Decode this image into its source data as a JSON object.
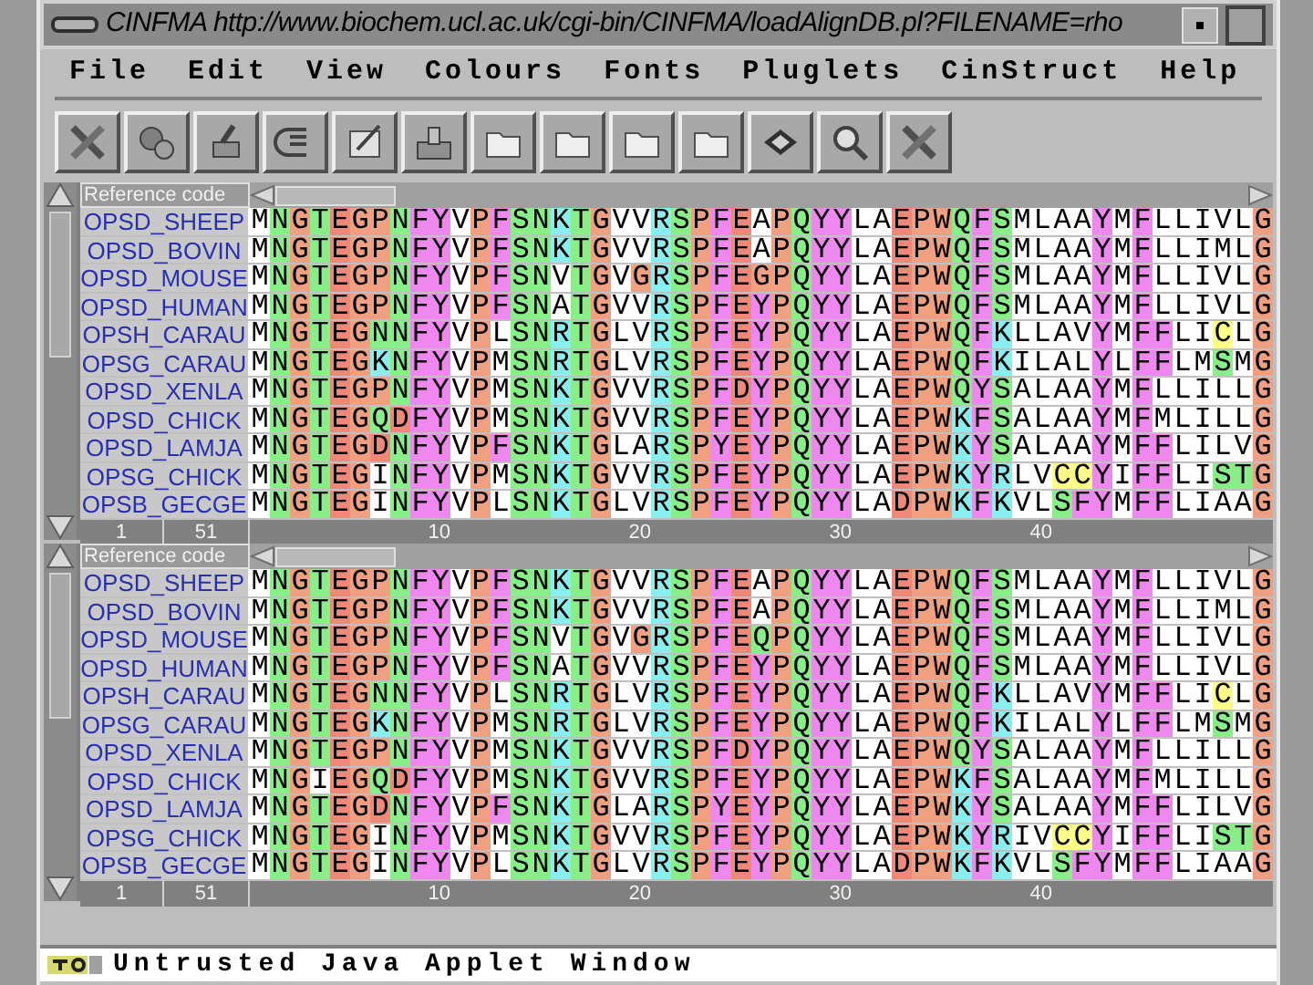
{
  "window": {
    "title": "CINFMA http://www.biochem.ucl.ac.uk/cgi-bin/CINFMA/loadAlignDB.pl?FILENAME=rho"
  },
  "menu": [
    "File",
    "Edit",
    "View",
    "Colours",
    "Fonts",
    "Pluglets",
    "CinStruct",
    "Help"
  ],
  "panels": [
    {
      "header": "Reference code",
      "start": "1",
      "end": "51",
      "ruler": [
        "10",
        "20",
        "30",
        "40"
      ],
      "rows": [
        {
          "name": "OPSD_SHEEP",
          "sequence": "MNGTEGPNFYVPFSNKTGVVRSPFEAPQYYLAEPWQFSMLAAYMFLLIVLG"
        },
        {
          "name": "OPSD_BOVIN",
          "sequence": "MNGTEGPNFYVPFSNKTGVVRSPFEAPQYYLAEPWQFSMLAAYMFLLIMLG"
        },
        {
          "name": "OPSD_MOUSE",
          "sequence": "MNGTEGPNFYVPFSNVTGVGRSPFEGPQYYLAEPWQFSMLAAYMFLLIVLG"
        },
        {
          "name": "OPSD_HUMAN",
          "sequence": "MNGTEGPNFYVPFSNATGVVRSPFEYPQYYLAEPWQFSMLAAYMFLLIVLG"
        },
        {
          "name": "OPSH_CARAU",
          "sequence": "MNGTEGNNFYVPLSNRTGLVRSPFEYPQYYLAEPWQFKLLAVYMFFLICLG"
        },
        {
          "name": "OPSG_CARAU",
          "sequence": "MNGTEGKNFYVPMSNRTGLVRSPFEYPQYYLAEPWQFKILALYLFFLMSMG"
        },
        {
          "name": "OPSD_XENLA",
          "sequence": "MNGTEGPNFYVPMSNKTGVVRSPFDYPQYYLAEPWQYSALAAYMFLLILLG"
        },
        {
          "name": "OPSD_CHICK",
          "sequence": "MNGTEGQDFYVPMSNKTGVVRSPFEYPQYYLAEPWKFSALAAYMFMLILLG"
        },
        {
          "name": "OPSD_LAMJA",
          "sequence": "MNGTEGDNFYVPFSNKTGLARSPYEYPQYYLAEPWKYSALAAYMFFLILVG"
        },
        {
          "name": "OPSG_CHICK",
          "sequence": "MNGTEGINFYVPMSNKTGVVRSPFEYPQYYLAEPWKYRLVCCYIFFLISTG"
        },
        {
          "name": "OPSB_GECGE",
          "sequence": "MNGTEGINFYVPLSNKTGLVRSPFEYPQYYLADPWKFKVLSFYMFFLIAAG"
        }
      ]
    },
    {
      "header": "Reference code",
      "start": "1",
      "end": "51",
      "ruler": [
        "10",
        "20",
        "30",
        "40"
      ],
      "rows": [
        {
          "name": "OPSD_SHEEP",
          "sequence": "MNGTEGPNFYVPFSNKTGVVRSPFEAPQYYLAEPWQFSMLAAYMFLLIVLG"
        },
        {
          "name": "OPSD_BOVIN",
          "sequence": "MNGTEGPNFYVPFSNKTGVVRSPFEAPQYYLAEPWQFSMLAAYMFLLIMLG"
        },
        {
          "name": "OPSD_MOUSE",
          "sequence": "MNGTEGPNFYVPFSNVTGVGRSPFEQPQYYLAEPWQFSMLAAYMFLLIVLG"
        },
        {
          "name": "OPSD_HUMAN",
          "sequence": "MNGTEGPNFYVPFSNATGVVRSPFEYPQYYLAEPWQFSMLAAYMFLLIVLG"
        },
        {
          "name": "OPSH_CARAU",
          "sequence": "MNGTEGNNFYVPLSNRTGLVRSPFEYPQYYLAEPWQFKLLAVYMFFLICLG"
        },
        {
          "name": "OPSG_CARAU",
          "sequence": "MNGTEGKNFYVPMSNRTGLVRSPFEYPQYYLAEPWQFKILALYLFFLMSMG"
        },
        {
          "name": "OPSD_XENLA",
          "sequence": "MNGTEGPNFYVPMSNKTGVVRSPFDYPQYYLAEPWQYSALAAYMFLLILLG"
        },
        {
          "name": "OPSD_CHICK",
          "sequence": "MNGIEGQDFYVPMSNKTGVVRSPFEYPQYYLAEPWKFSALAAYMFMLILLG"
        },
        {
          "name": "OPSD_LAMJA",
          "sequence": "MNGTEGDNFYVPFSNKTGLARSPYEYPQYYLAEPWKYSALAAYMFFLILVG"
        },
        {
          "name": "OPSG_CHICK",
          "sequence": "MNGTEGINFYVPMSNKTGVVRSPFEYPQYYLAEPWKYRIVCCYIFFLISTG"
        },
        {
          "name": "OPSB_GECGE",
          "sequence": "MNGTEGINFYVPLSNKTGLVRSPFEYPQYYLADPWKFKVLSFYMFFLIAAG"
        }
      ]
    }
  ],
  "status_bar": {
    "text": "Untrusted Java Applet Window"
  }
}
